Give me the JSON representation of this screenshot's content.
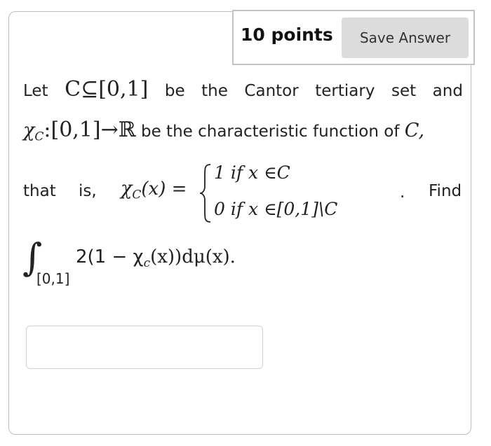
{
  "header": {
    "points": "10 points",
    "save_label": "Save Answer"
  },
  "question": {
    "line1_words": [
      "Let",
      "C⊆[0,1]",
      "be",
      "the",
      "Cantor",
      "tertiary",
      "set",
      "and"
    ],
    "line2_prefix": "χ",
    "line2_sub": "C",
    "line2_map": ":[0,1]→ℝ",
    "line2_text": "be the characteristic function of",
    "line2_end": "C,",
    "line3_lead": "that",
    "line3_is": "is,",
    "chi_lhs": "χ",
    "chi_lhs_sub": "C",
    "chi_lhs_arg": "(x) =",
    "case1": "1  if x ∈C",
    "case2": "0  if x ∈[0,1]\\C",
    "case_dot": ".",
    "line3_find": "Find",
    "integral_sign": "∫",
    "integral_domain": "[0,1]",
    "integrand": "2(1 − χ",
    "integrand_sub": "c",
    "integrand_tail": "(x))dμ(x)."
  },
  "answer": {
    "value": ""
  }
}
